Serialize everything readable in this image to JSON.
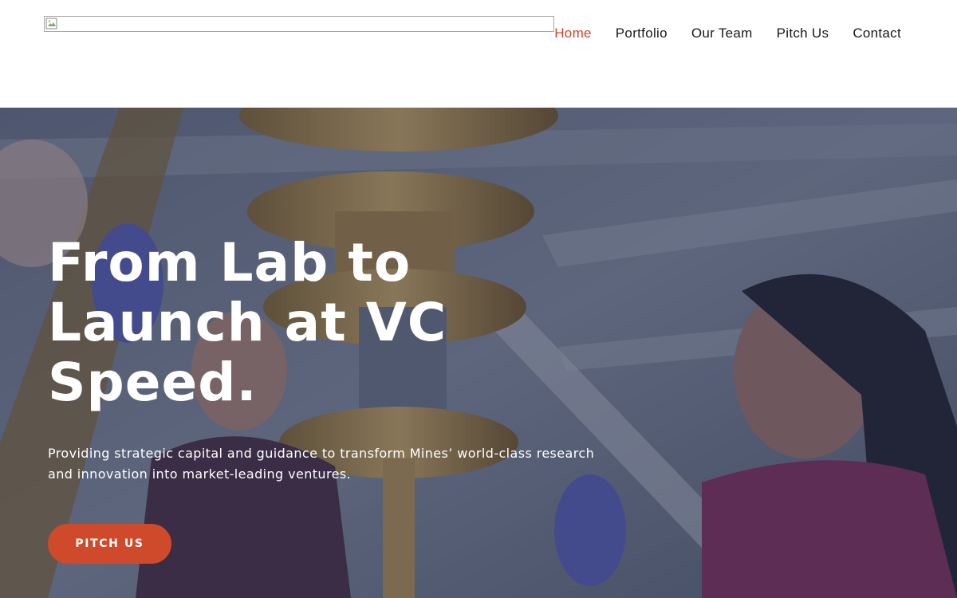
{
  "header": {
    "logo_alt": "",
    "nav": [
      {
        "label": "Home",
        "active": true
      },
      {
        "label": "Portfolio",
        "active": false
      },
      {
        "label": "Our Team",
        "active": false
      },
      {
        "label": "Pitch Us",
        "active": false
      },
      {
        "label": "Contact",
        "active": false
      }
    ]
  },
  "hero": {
    "title": "From Lab to Launch at VC Speed.",
    "subtitle": "Providing strategic capital and guidance to transform Mines’ world-class research and innovation into market-leading ventures.",
    "cta_label": "PITCH US"
  },
  "colors": {
    "accent": "#cf4a2a",
    "nav_active": "#c9462a",
    "nav_text": "#1a1a1a",
    "hero_overlay": "#283050"
  },
  "icons": {
    "logo": "broken-image-icon"
  }
}
